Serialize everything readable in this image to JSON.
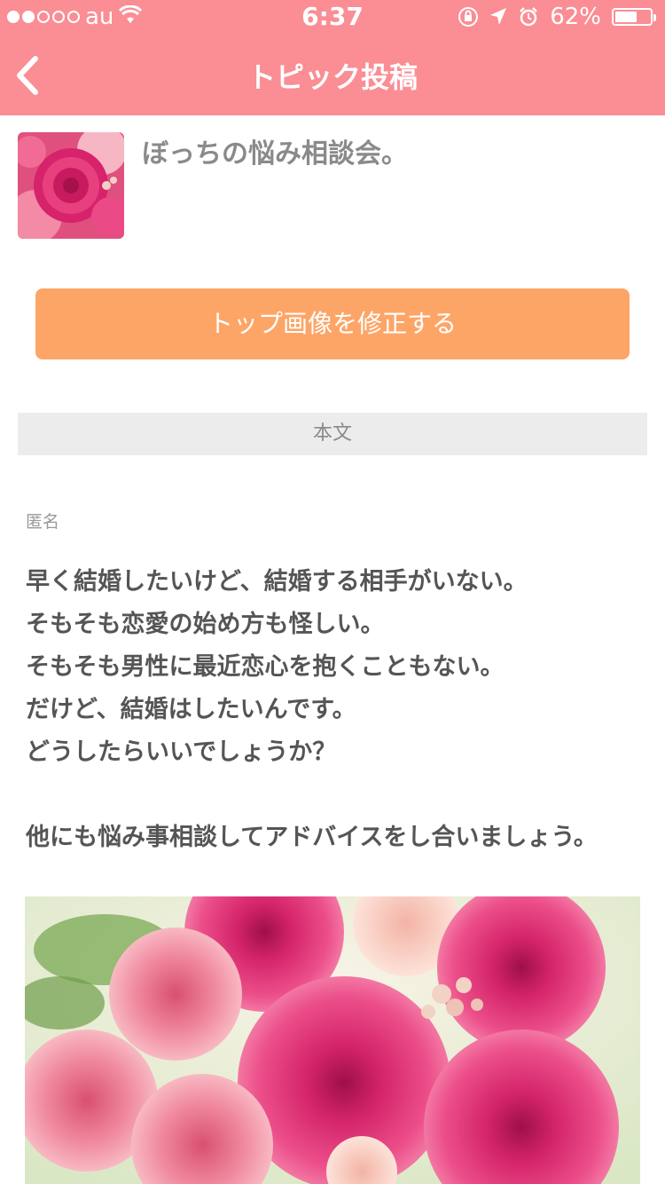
{
  "status_bar": {
    "carrier": "au",
    "time": "6:37",
    "battery_percent_label": "62%",
    "battery_level": 0.62,
    "signal_bars_filled": 2,
    "signal_bars_total": 5
  },
  "nav": {
    "title": "トピック投稿",
    "back_icon": "chevron-left-icon"
  },
  "topic": {
    "title": "ぼっちの悩み相談会。",
    "thumbnail": "pink-flowers-image"
  },
  "edit_button_label": "トップ画像を修正する",
  "section_label": "本文",
  "author_label": "匿名",
  "body": {
    "text": "早く結婚したいけど、結婚する相手がいない。\nそもそも恋愛の始め方も怪しい。\nそもそも男性に最近恋心を抱くこともない。\nだけど、結婚はしたいんです。\nどうしたらいいでしょうか？\n\n他にも悩み事相談してアドバイスをし合いましょう。",
    "image": "pink-dahlia-rose-bouquet-image"
  },
  "colors": {
    "header": "#fa8e94",
    "button": "#fda567",
    "section_bar": "#ececec"
  }
}
